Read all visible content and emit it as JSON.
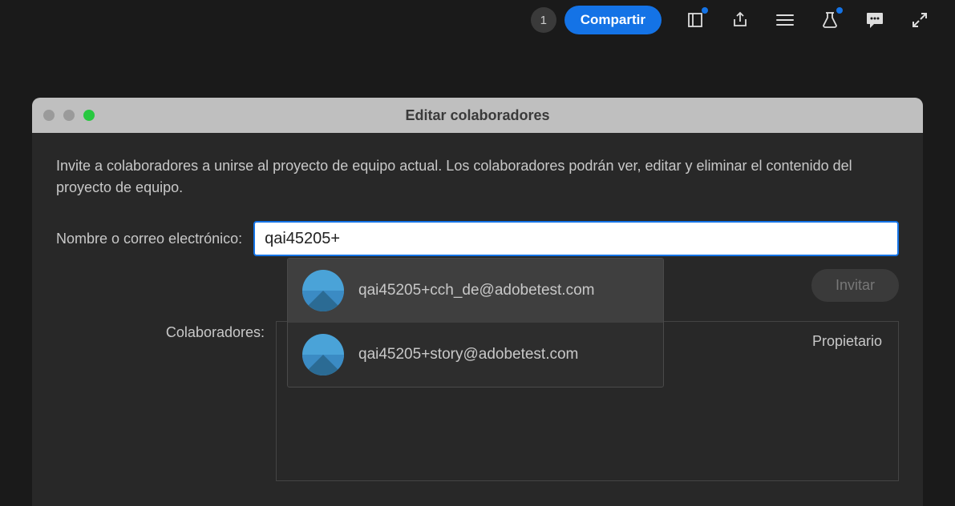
{
  "toolbar": {
    "badge_count": "1",
    "share_label": "Compartir"
  },
  "dialog": {
    "title": "Editar colaboradores",
    "description": "Invite a colaboradores a unirse al proyecto de equipo actual. Los colaboradores podrán ver, editar y eliminar el contenido del proyecto de equipo.",
    "input_label": "Nombre o correo electrónico:",
    "input_value": "qai45205+",
    "invite_label": "Invitar",
    "collaborators_label": "Colaboradores:",
    "owner_label": "Propietario"
  },
  "suggestions": [
    {
      "email": "qai45205+cch_de@adobetest.com",
      "active": true
    },
    {
      "email": "qai45205+story@adobetest.com",
      "active": false
    }
  ]
}
